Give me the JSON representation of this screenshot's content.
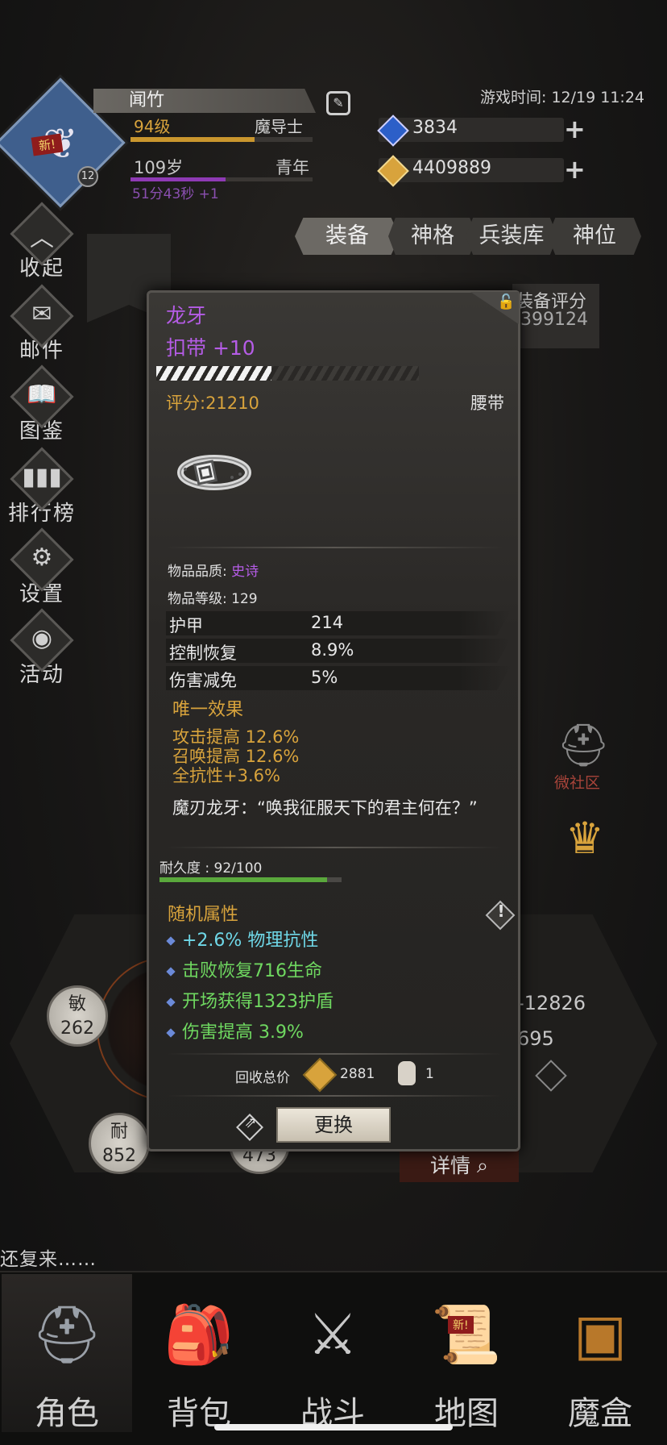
{
  "header": {
    "avatar_new": "新!",
    "avatar_level": "12",
    "name": "闻竹",
    "level": "94级",
    "class": "魔导士",
    "xp_progress": 0.68,
    "age": "109岁",
    "age_phase": "青年",
    "age_progress": 0.52,
    "timer": "51分43秒 +1",
    "game_time": "游戏时间: 12/19 11:24",
    "currency_blue": "3834",
    "currency_gold": "4409889",
    "plus": "+"
  },
  "side_menu": [
    {
      "label": "收起",
      "icon": "collapse-icon"
    },
    {
      "label": "邮件",
      "icon": "mail-icon"
    },
    {
      "label": "图鉴",
      "icon": "book-icon"
    },
    {
      "label": "排行榜",
      "icon": "ranking-icon"
    },
    {
      "label": "设置",
      "icon": "gear-icon"
    },
    {
      "label": "活动",
      "icon": "event-icon"
    }
  ],
  "tabs": [
    {
      "label": "装备",
      "active": true
    },
    {
      "label": "神格",
      "active": false
    },
    {
      "label": "兵装库",
      "active": false
    },
    {
      "label": "神位",
      "active": false
    }
  ],
  "equip_score": {
    "label": "装备评分",
    "value": "399124"
  },
  "item": {
    "name": "龙牙",
    "subtype": "扣带 +10",
    "enhance_progress": 0.44,
    "score": "评分:21210",
    "slot": "腰带",
    "quality_label": "物品品质: ",
    "quality": "史诗",
    "item_level": "物品等级: 129",
    "stats": [
      {
        "name": "护甲",
        "value": "214"
      },
      {
        "name": "控制恢复",
        "value": "8.9%"
      },
      {
        "name": "伤害减免",
        "value": "5%"
      }
    ],
    "unique_header": "唯一效果",
    "unique_effects": [
      "攻击提高 12.6%",
      "召唤提高 12.6%",
      "全抗性+3.6%"
    ],
    "quote": "魔刃龙牙：“唤我征服天下的君主何在？”",
    "durability_label": "耐久度 : 92/100",
    "durability": 0.92,
    "random_header": "随机属性",
    "random_attrs": [
      {
        "text": "+2.6% 物理抗性",
        "color": "#6fd8e8"
      },
      {
        "text": "击败恢复716生命",
        "color": "#6fd860"
      },
      {
        "text": "开场获得1323护盾",
        "color": "#6fd860"
      },
      {
        "text": "伤害提高 3.9%",
        "color": "#6fd860"
      }
    ],
    "recycle_label": "回收总价",
    "recycle_gold": "2881",
    "recycle_bag": "1",
    "replace_button": "更换"
  },
  "background_stats": {
    "agi_label": "敏",
    "agi_value": "262",
    "end_label": "耐",
    "end_value": "852",
    "hidden_value": "473",
    "right_val1": "-12826",
    "right_val2": "695",
    "detail_button": "详情",
    "micro_community": "微社区"
  },
  "log_text": "还复来……",
  "bottom_nav": [
    {
      "label": "角色",
      "icon": "helmet-icon",
      "active": true
    },
    {
      "label": "背包",
      "icon": "backpack-icon",
      "active": false
    },
    {
      "label": "战斗",
      "icon": "sword-shield-icon",
      "active": false
    },
    {
      "label": "地图",
      "icon": "scroll-map-icon",
      "active": false
    },
    {
      "label": "魔盒",
      "icon": "magic-box-icon",
      "active": false
    }
  ],
  "nav_new_tag": "新!",
  "colors": {
    "gold": "#d8a33c",
    "epic_purple": "#b55ce6",
    "accent_green": "#6fd860"
  }
}
